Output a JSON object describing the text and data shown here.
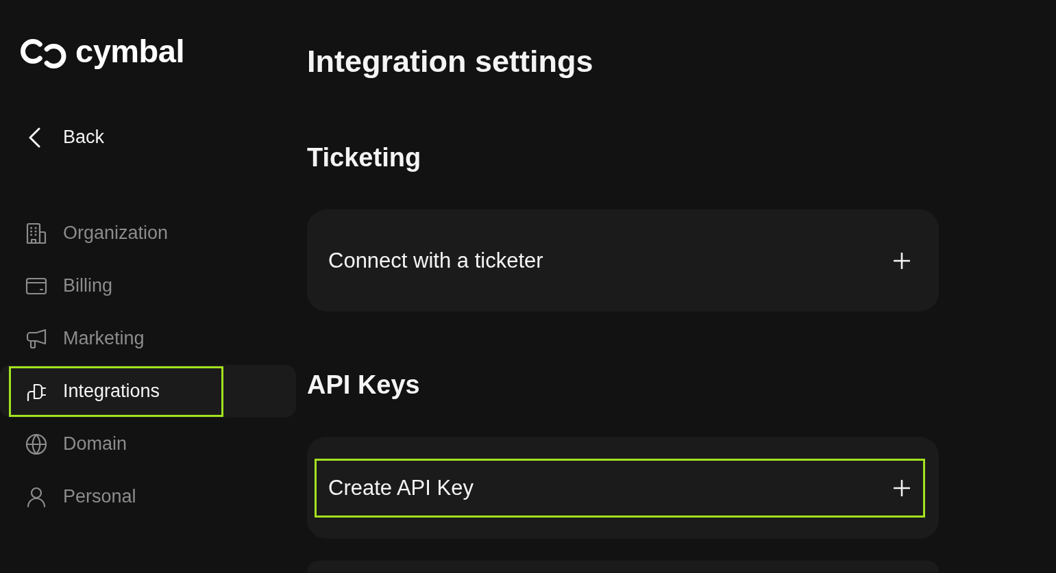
{
  "logo": {
    "name": "cymbal"
  },
  "back": {
    "label": "Back"
  },
  "sidebar": {
    "items": [
      {
        "label": "Organization",
        "selected": false,
        "highlighted": false
      },
      {
        "label": "Billing",
        "selected": false,
        "highlighted": false
      },
      {
        "label": "Marketing",
        "selected": false,
        "highlighted": false
      },
      {
        "label": "Integrations",
        "selected": true,
        "highlighted": true
      },
      {
        "label": "Domain",
        "selected": false,
        "highlighted": false
      },
      {
        "label": "Personal",
        "selected": false,
        "highlighted": false
      }
    ]
  },
  "page": {
    "title": "Integration settings"
  },
  "sections": [
    {
      "heading": "Ticketing",
      "action": {
        "label": "Connect with a ticketer",
        "highlighted": false
      }
    },
    {
      "heading": "API Keys",
      "action": {
        "label": "Create API Key",
        "highlighted": true
      }
    }
  ]
}
